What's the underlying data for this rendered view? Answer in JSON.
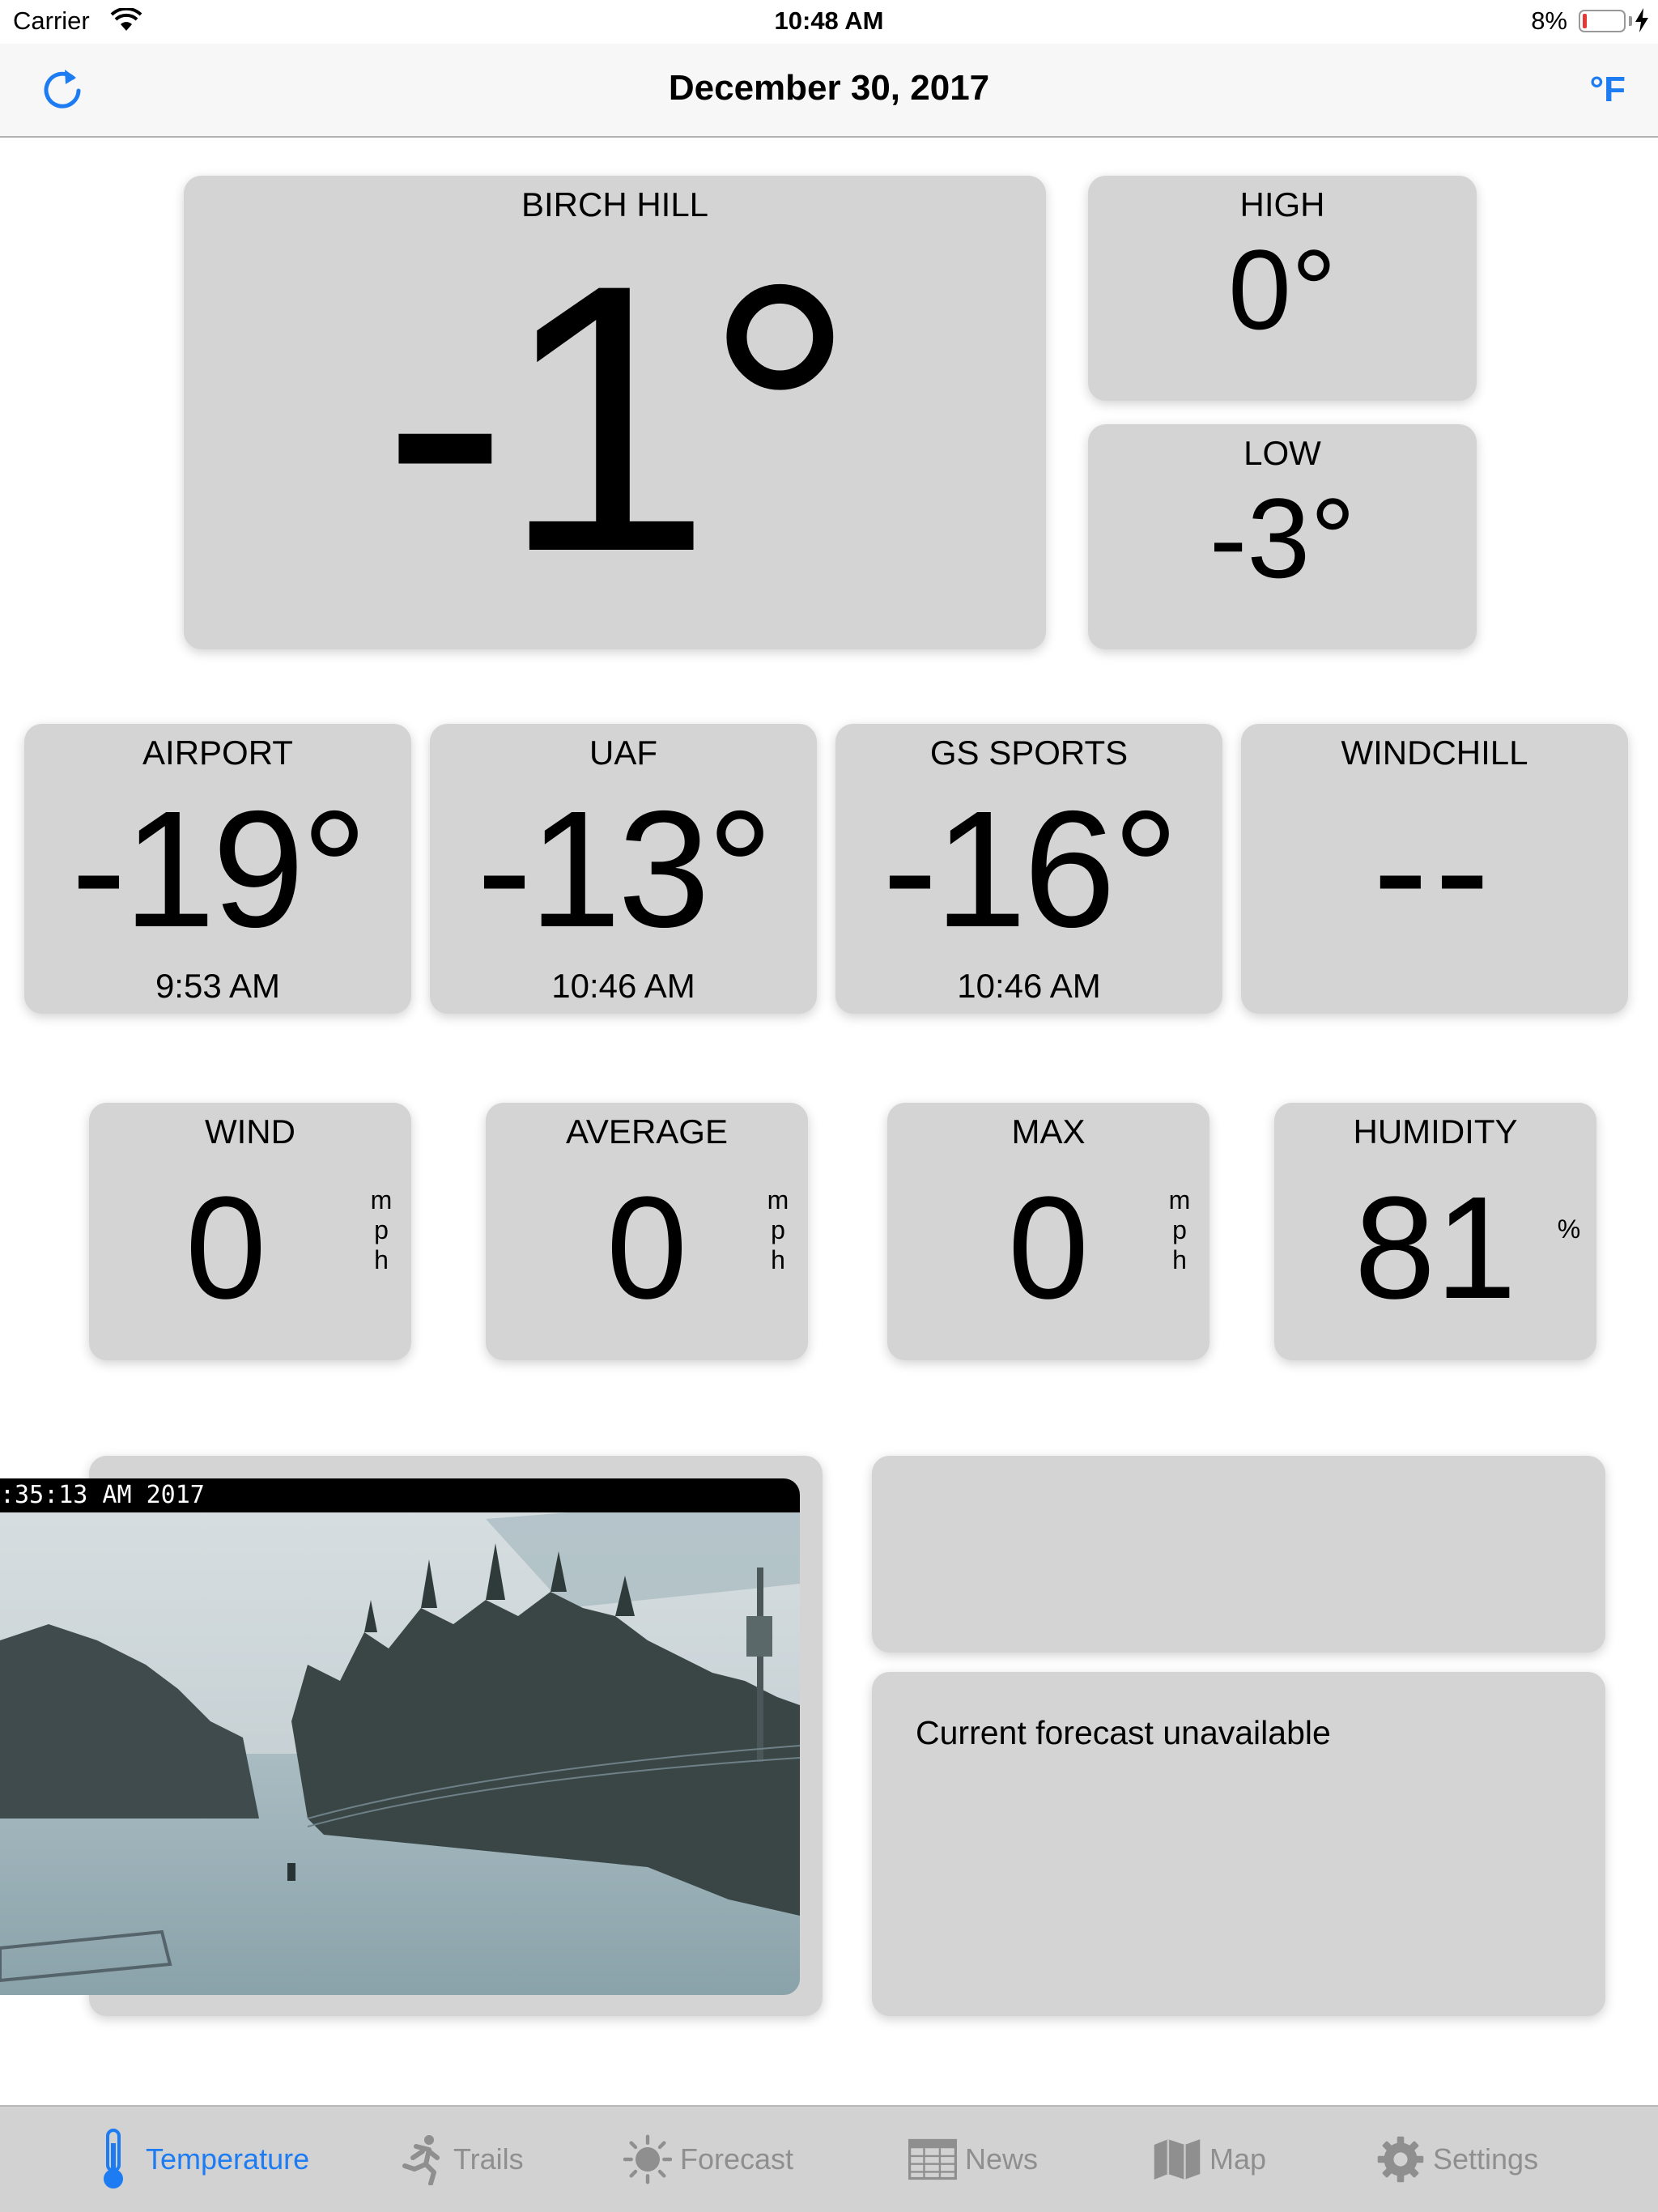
{
  "status_bar": {
    "carrier": "Carrier",
    "time": "10:48 AM",
    "battery": "8%"
  },
  "nav": {
    "title": "December 30, 2017",
    "unit_toggle": "°F",
    "refresh_icon": "refresh-icon"
  },
  "main_station": {
    "name": "BIRCH HILL",
    "temp": "-1°"
  },
  "high": {
    "label": "HIGH",
    "value": "0°"
  },
  "low": {
    "label": "LOW",
    "value": "-3°"
  },
  "stations": [
    {
      "name": "AIRPORT",
      "temp": "-19°",
      "time": "9:53 AM"
    },
    {
      "name": "UAF",
      "temp": "-13°",
      "time": "10:46 AM"
    },
    {
      "name": "GS SPORTS",
      "temp": "-16°",
      "time": "10:46 AM"
    },
    {
      "name": "WINDCHILL",
      "temp": "--",
      "time": ""
    }
  ],
  "wind": [
    {
      "label": "WIND",
      "value": "0",
      "unit": "mph"
    },
    {
      "label": "AVERAGE",
      "value": "0",
      "unit": "mph"
    },
    {
      "label": "MAX",
      "value": "0",
      "unit": "mph"
    },
    {
      "label": "HUMIDITY",
      "value": "81",
      "unit": "%"
    }
  ],
  "webcam": {
    "timestamp": ":35:13 AM  2017"
  },
  "forecast": {
    "message": "Current forecast unavailable"
  },
  "tabs": [
    {
      "label": "Temperature",
      "icon": "thermometer-icon",
      "active": true
    },
    {
      "label": "Trails",
      "icon": "runner-icon",
      "active": false
    },
    {
      "label": "Forecast",
      "icon": "sun-icon",
      "active": false
    },
    {
      "label": "News",
      "icon": "newspaper-icon",
      "active": false
    },
    {
      "label": "Map",
      "icon": "map-icon",
      "active": false
    },
    {
      "label": "Settings",
      "icon": "gear-icon",
      "active": false
    }
  ],
  "colors": {
    "accent": "#1e7cf2",
    "card": "#d4d4d4",
    "tab_inactive": "#8f8f8f"
  }
}
